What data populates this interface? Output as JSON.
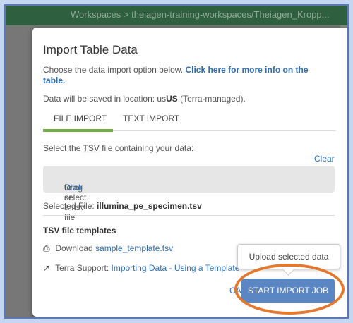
{
  "header": {
    "breadcrumb": "Workspaces > theiagen-training-workspaces/Theiagen_Kropp..."
  },
  "modal": {
    "title": "Import Table Data",
    "intro_text": "Choose the data import option below. ",
    "intro_link": "Click here for more info on the table.",
    "location_prefix": "Data will be saved in location: us",
    "location_bold": "US",
    "location_suffix": " (Terra-managed).",
    "tabs": [
      "FILE IMPORT",
      "TEXT IMPORT"
    ],
    "select_prefix": "Select the ",
    "select_tsv": "TSV",
    "select_suffix": " file containing your data:",
    "clear_label": "Clear",
    "drop_prefix": "Drag or ",
    "drop_click": "Click",
    "drop_suffix": " to select a .tsv file",
    "selected_label": "Selected File: ",
    "selected_file": "illumina_pe_specimen.tsv",
    "templates_heading": "TSV file templates",
    "download_label": "Download ",
    "download_link": "sample_template.tsv",
    "support_label": "Terra Support: ",
    "support_link": "Importing Data - Using a Template",
    "cancel_label": "CANCEL",
    "start_label": "START IMPORT JOB",
    "tooltip": "Upload selected data"
  },
  "colors": {
    "primary": "#5a86c4",
    "link": "#2f6fb7",
    "tab_active": "#74ae43",
    "highlight_ring": "#e3782f"
  },
  "icons": {
    "download": "printer-download-icon",
    "external": "external-link-icon"
  }
}
